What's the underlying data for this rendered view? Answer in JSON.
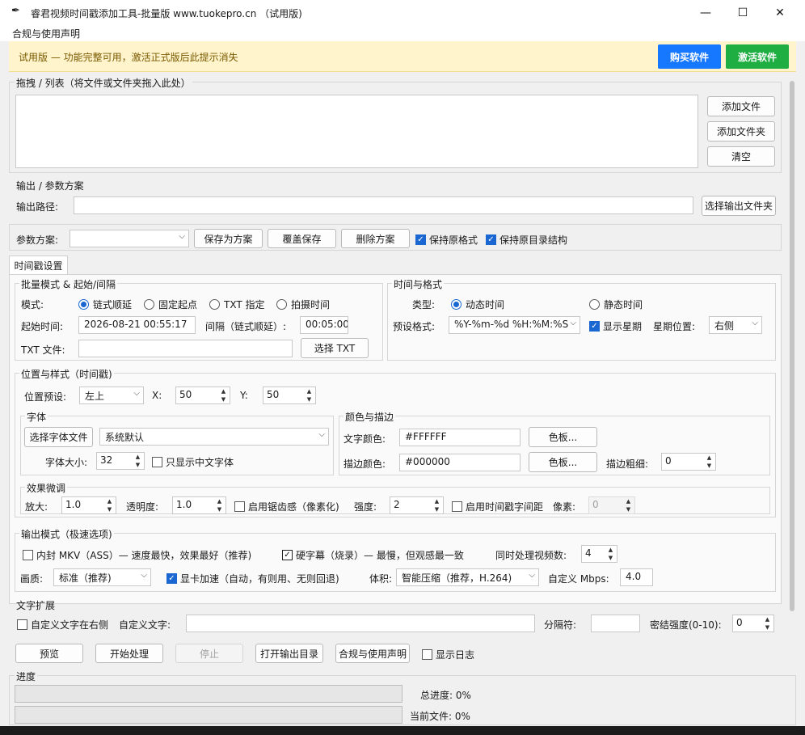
{
  "window": {
    "title": "睿君视频时间戳添加工具-批量版 www.tuokepro.cn （试用版)",
    "minimize": "—",
    "maximize": "☐",
    "close": "✕"
  },
  "menu": {
    "items": [
      "合规与使用声明"
    ]
  },
  "banner": {
    "text": "试用版 — 功能完整可用，激活正式版后此提示消失",
    "buy": "购买软件",
    "activate": "激活软件",
    "buy_color": "#1677ff",
    "activate_color": "#1fae42"
  },
  "dropzone": {
    "title": "拖拽 / 列表（将文件或文件夹拖入此处）",
    "add_file": "添加文件",
    "add_folder": "添加文件夹",
    "clear": "清空"
  },
  "output": {
    "title": "输出 / 参数方案",
    "path_label": "输出路径:",
    "path_value": "",
    "choose_folder": "选择输出文件夹",
    "scheme_label": "参数方案:",
    "scheme_value": "",
    "save_as": "保存为方案",
    "overwrite": "覆盖保存",
    "delete": "删除方案",
    "keep_format": "保持原格式",
    "keep_dirs": "保持原目录结构"
  },
  "tab": {
    "label": "时间戳设置"
  },
  "batch": {
    "title": "批量模式 & 起始/间隔",
    "mode_label": "模式:",
    "modes": [
      "链式顺延",
      "固定起点",
      "TXT 指定",
      "拍摄时间"
    ],
    "start_label": "起始时间:",
    "start_value": "2026-08-21 00:55:17",
    "interval_label": "间隔（链式顺延）:",
    "interval_value": "00:05:00",
    "txt_label": "TXT 文件:",
    "txt_value": "",
    "choose_txt": "选择 TXT"
  },
  "timefmt": {
    "title": "时间与格式",
    "type_label": "类型:",
    "dynamic": "动态时间",
    "static": "静态时间",
    "preset_label": "预设格式:",
    "preset_value": "%Y-%m-%d %H:%M:%S",
    "show_week": "显示星期",
    "week_pos_label": "星期位置:",
    "week_pos_value": "右侧"
  },
  "position": {
    "title": "位置与样式（时间戳)",
    "preset_label": "位置预设:",
    "preset_value": "左上",
    "x_label": "X:",
    "x_value": "50",
    "y_label": "Y:",
    "y_value": "50"
  },
  "font": {
    "title": "字体",
    "choose": "选择字体文件",
    "font_value": "系统默认",
    "size_label": "字体大小:",
    "size_value": "32",
    "cn_only": "只显示中文字体"
  },
  "color": {
    "title": "颜色与描边",
    "text_label": "文字颜色:",
    "text_value": "#FFFFFF",
    "palette1": "色板...",
    "stroke_label": "描边颜色:",
    "stroke_value": "#000000",
    "palette2": "色板...",
    "stroke_w_label": "描边粗细:",
    "stroke_w_value": "0"
  },
  "effects": {
    "title": "效果微调",
    "scale_label": "放大:",
    "scale_value": "1.0",
    "opacity_label": "透明度:",
    "opacity_value": "1.0",
    "pixel_label": "启用锯齿感（像素化)",
    "strength_label": "强度:",
    "strength_value": "2",
    "spacing_label": "启用时间戳字间距",
    "px_label": "像素:",
    "px_value": "0"
  },
  "outmode": {
    "title": "输出模式（极速选项)",
    "mkv": "内封 MKV（ASS）— 速度最快，效果最好（推荐)",
    "hardsub": "硬字幕（烧录）— 最慢，但观感最一致",
    "concurrent_label": "同时处理视频数:",
    "concurrent_value": "4",
    "quality_label": "画质:",
    "quality_value": "标准（推荐)",
    "gpu": "显卡加速（自动，有则用、无则回退)",
    "size_label": "体积:",
    "size_value": "智能压缩（推荐，H.264)",
    "mbps_label": "自定义 Mbps:",
    "mbps_value": "4.0"
  },
  "textext": {
    "title": "文字扩展",
    "right_custom": "自定义文字在右侧",
    "custom_label": "自定义文字:",
    "custom_value": "",
    "sep_label": "分隔符:",
    "sep_value": "",
    "density_label": "密结强度(0-10):",
    "density_value": "0"
  },
  "actions": {
    "preview": "预览",
    "start": "开始处理",
    "stop": "停止",
    "open_out": "打开输出目录",
    "compliance": "合规与使用声明",
    "show_log": "显示日志"
  },
  "progress": {
    "title": "进度",
    "total_label": "总进度: 0%",
    "current_label": "当前文件: 0%",
    "total": 0,
    "current": 0
  }
}
